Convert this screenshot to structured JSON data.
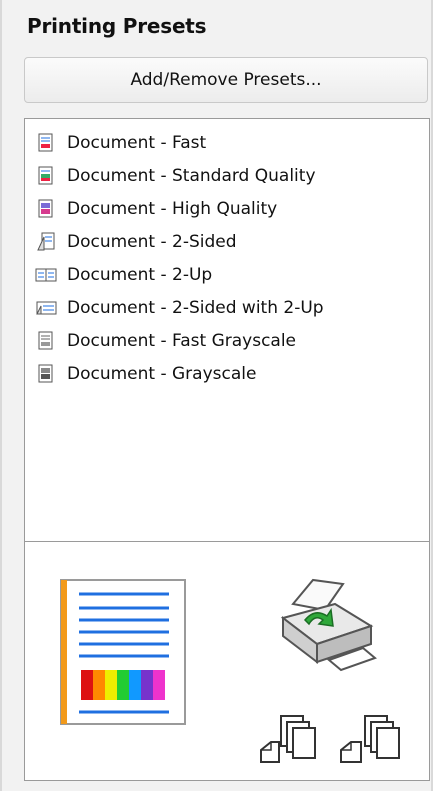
{
  "panel": {
    "title": "Printing Presets",
    "add_remove_label": "Add/Remove Presets...",
    "presets": [
      {
        "label": "Document - Fast",
        "icon": "fast-doc-icon"
      },
      {
        "label": "Document - Standard Quality",
        "icon": "standard-quality-doc-icon"
      },
      {
        "label": "Document - High Quality",
        "icon": "high-quality-doc-icon"
      },
      {
        "label": "Document - 2-Sided",
        "icon": "two-sided-doc-icon"
      },
      {
        "label": "Document - 2-Up",
        "icon": "two-up-doc-icon"
      },
      {
        "label": "Document - 2-Sided with 2-Up",
        "icon": "two-sided-two-up-doc-icon"
      },
      {
        "label": "Document - Fast Grayscale",
        "icon": "fast-grayscale-doc-icon"
      },
      {
        "label": "Document - Grayscale",
        "icon": "grayscale-doc-icon"
      }
    ]
  },
  "preview": {
    "page_icon": "page-preview-icon",
    "printer_icon": "printer-icon",
    "collate_icons": [
      "collated-copies-icon",
      "uncollated-copies-icon"
    ],
    "colors": {
      "accent": "#1f6fe0",
      "margin": "#f29a1b",
      "printer_arrow": "#2fa83a"
    }
  }
}
